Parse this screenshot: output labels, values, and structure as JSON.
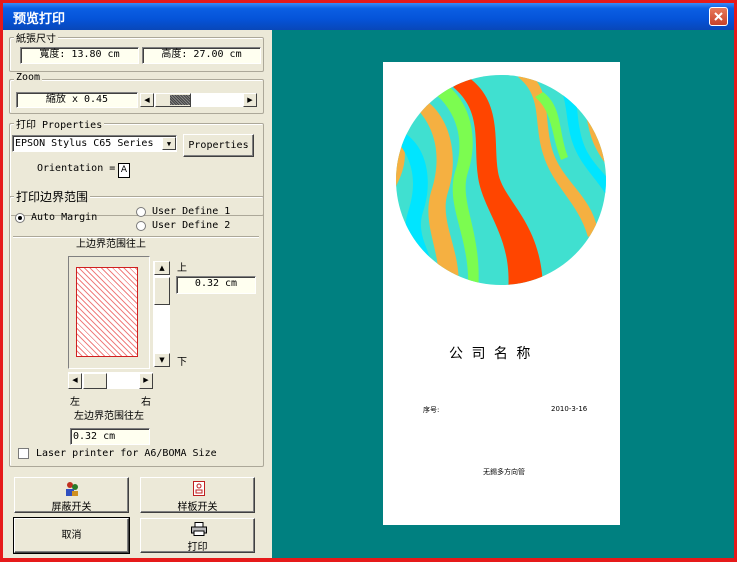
{
  "window": {
    "title": "预览打印"
  },
  "paper_size": {
    "legend": "紙張尺寸",
    "width_field": "寬度: 13.80 cm",
    "height_field": "高度: 27.00 cm"
  },
  "zoom": {
    "legend": "Zoom",
    "field": "縮放 x  0.45"
  },
  "print_properties": {
    "legend": "打印 Properties",
    "printer_selected": "EPSON Stylus C65 Series",
    "properties_button": "Properties",
    "orientation_label": "Orientation =",
    "orientation_glyph": "A"
  },
  "margins": {
    "legend": "打印边界范围",
    "auto_margin": "Auto Margin",
    "user_define_1": "User Define 1",
    "user_define_2": "User Define 2",
    "top_caption": "上边界范围往上",
    "up_label": "上",
    "down_label": "下",
    "top_value": "0.32 cm",
    "left_label": "左",
    "right_label": "右",
    "left_caption": "左边界范围往左",
    "left_value": "0.32 cm",
    "laser_label": "Laser printer for A6/BOMA Size"
  },
  "buttons": {
    "mask_toggle": "屏蔽开关",
    "template_toggle": "样板开关",
    "cancel": "取消",
    "print": "打印"
  },
  "preview": {
    "company_name": "公 司 名 称",
    "serial_label": "序号:",
    "date": "2010-3-16",
    "footer": "无錫多方向管"
  },
  "colors": {
    "preview_bg": "#008080",
    "titlebar": "#0553d8",
    "frame": "#e61a1a",
    "panel": "#ece9d8",
    "field_bg": "#fffff0"
  },
  "icons": {
    "mask_toggle": "people-icon",
    "template_toggle": "template-icon",
    "print": "printer-icon",
    "orientation": "portrait-icon",
    "close": "close-icon",
    "dropdown": "chevron-down-icon"
  }
}
